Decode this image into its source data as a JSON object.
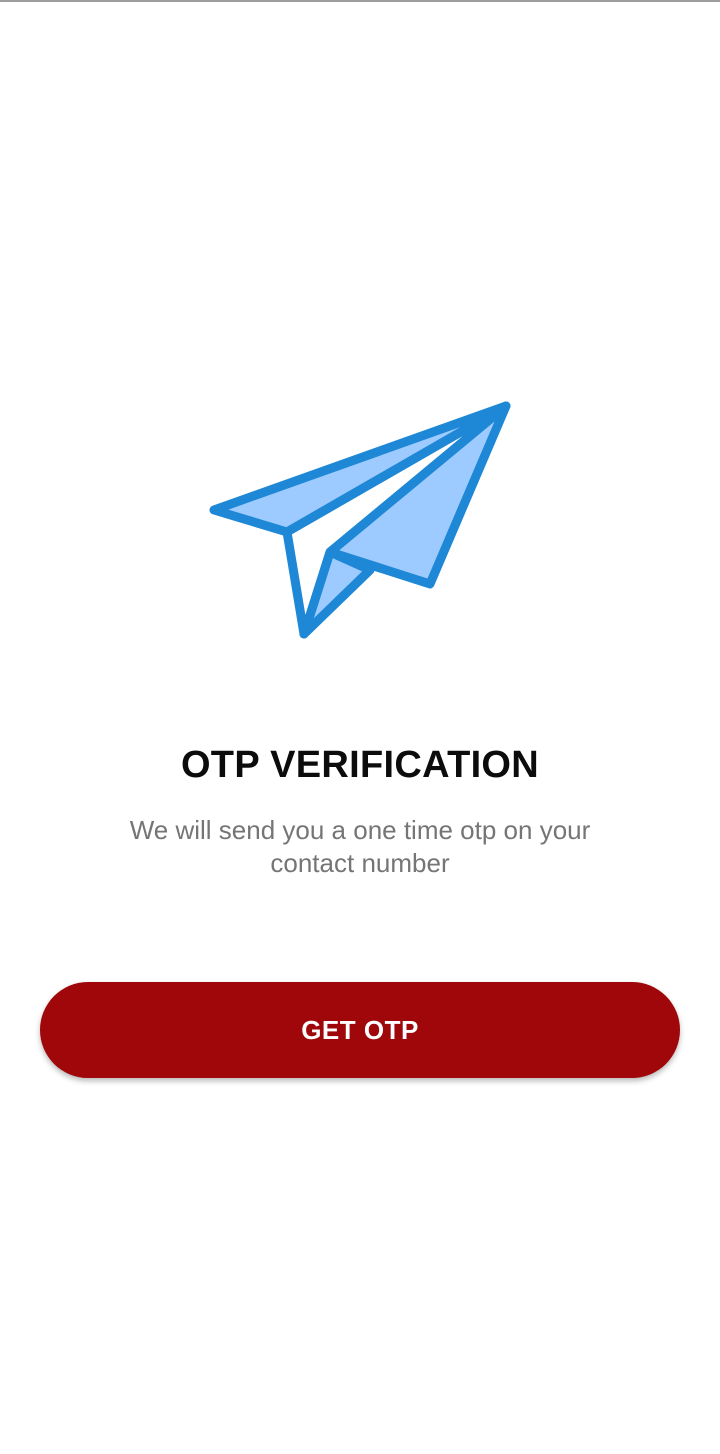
{
  "illustration": {
    "icon": "paper-plane-icon",
    "stroke_color": "#1e88d6",
    "fill_color": "#9ecbff"
  },
  "otp_screen": {
    "title": "OTP VERIFICATION",
    "subtitle": "We will send you a one time otp on your contact number",
    "button_label": "GET OTP"
  },
  "colors": {
    "button_background": "#a0070a",
    "button_text": "#ffffff",
    "title_text": "#0c0c0c",
    "subtitle_text": "#757575"
  }
}
